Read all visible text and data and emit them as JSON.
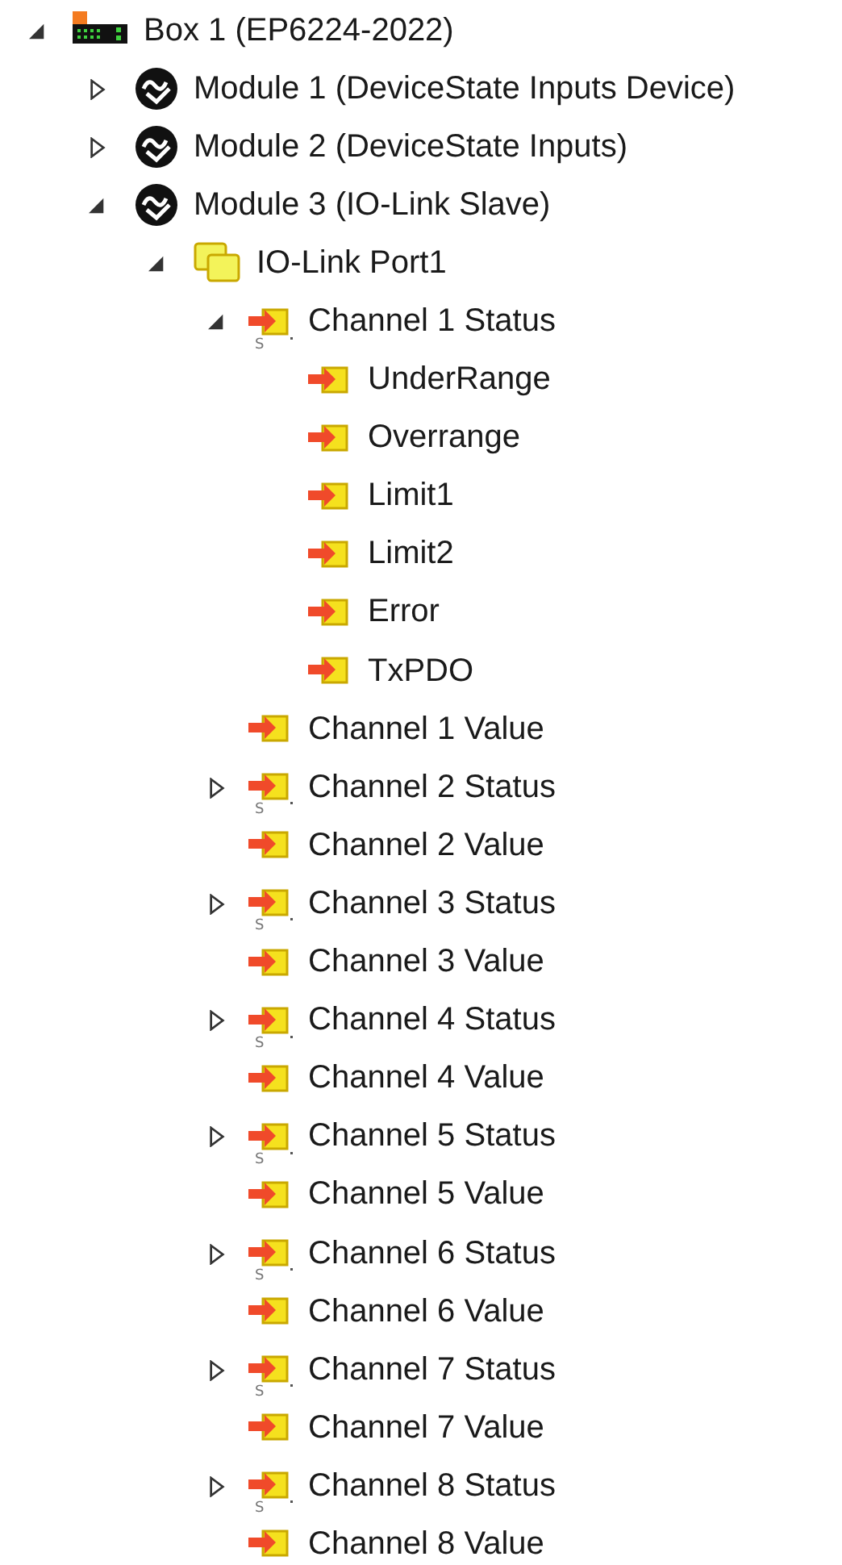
{
  "tree": [
    {
      "kind": "box",
      "label": "Box 1 (EP6224-2022)",
      "expanded": true,
      "children": [
        {
          "kind": "module",
          "label": "Module 1 (DeviceState Inputs Device)",
          "expanded": false
        },
        {
          "kind": "module",
          "label": "Module 2 (DeviceState Inputs)",
          "expanded": false
        },
        {
          "kind": "module",
          "label": "Module 3 (IO-Link Slave)",
          "expanded": true,
          "children": [
            {
              "kind": "port",
              "label": "IO-Link Port1",
              "expanded": true,
              "children": [
                {
                  "kind": "status",
                  "label": "Channel 1 Status",
                  "badge": "S",
                  "expanded": true,
                  "children": [
                    {
                      "kind": "var",
                      "label": "UnderRange"
                    },
                    {
                      "kind": "var",
                      "label": "Overrange"
                    },
                    {
                      "kind": "var",
                      "label": "Limit1"
                    },
                    {
                      "kind": "var",
                      "label": "Limit2"
                    },
                    {
                      "kind": "var",
                      "label": "Error"
                    },
                    {
                      "kind": "var",
                      "label": "TxPDO"
                    }
                  ]
                },
                {
                  "kind": "var",
                  "label": "Channel 1 Value"
                },
                {
                  "kind": "status",
                  "label": "Channel 2 Status",
                  "badge": "S",
                  "expanded": false
                },
                {
                  "kind": "var",
                  "label": "Channel 2 Value"
                },
                {
                  "kind": "status",
                  "label": "Channel 3 Status",
                  "badge": "S",
                  "expanded": false
                },
                {
                  "kind": "var",
                  "label": "Channel 3 Value"
                },
                {
                  "kind": "status",
                  "label": "Channel 4 Status",
                  "badge": "S",
                  "expanded": false
                },
                {
                  "kind": "var",
                  "label": "Channel 4 Value"
                },
                {
                  "kind": "status",
                  "label": "Channel 5 Status",
                  "badge": "S",
                  "expanded": false
                },
                {
                  "kind": "var",
                  "label": "Channel 5 Value"
                },
                {
                  "kind": "status",
                  "label": "Channel 6 Status",
                  "badge": "S",
                  "expanded": false
                },
                {
                  "kind": "var",
                  "label": "Channel 6 Value"
                },
                {
                  "kind": "status",
                  "label": "Channel 7 Status",
                  "badge": "S",
                  "expanded": false
                },
                {
                  "kind": "var",
                  "label": "Channel 7 Value"
                },
                {
                  "kind": "status",
                  "label": "Channel 8 Status",
                  "badge": "S",
                  "expanded": false
                },
                {
                  "kind": "var",
                  "label": "Channel 8 Value"
                }
              ]
            }
          ]
        }
      ]
    }
  ]
}
